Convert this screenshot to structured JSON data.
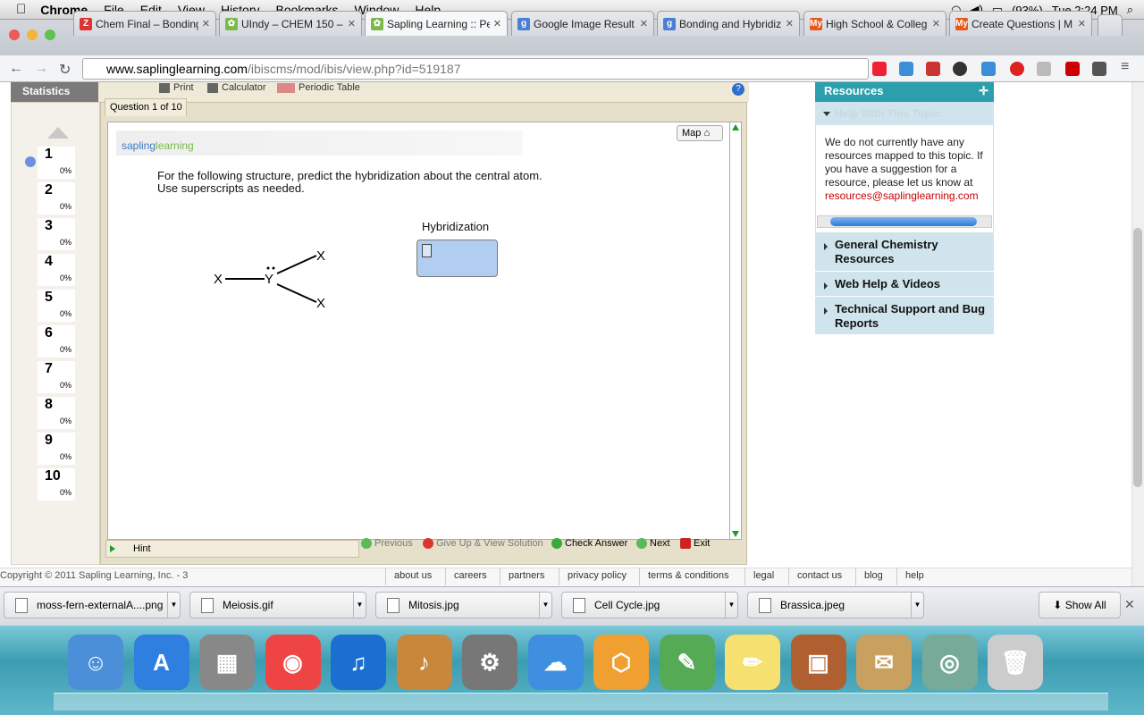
{
  "menubar": {
    "app": "Chrome",
    "items": [
      "File",
      "Edit",
      "View",
      "History",
      "Bookmarks",
      "Window",
      "Help"
    ],
    "battery": "(93%)",
    "clock": "Tue 2:24 PM"
  },
  "tabs": [
    {
      "title": "Chem Final – Bonding",
      "icon": "Z",
      "color": "#d33"
    },
    {
      "title": "UIndy – CHEM 150 –",
      "icon": "✿",
      "color": "#7bb94a"
    },
    {
      "title": "Sapling Learning :: Pe",
      "icon": "✿",
      "color": "#7bb94a"
    },
    {
      "title": "Google Image Result",
      "icon": "g",
      "color": "#4a7fd4"
    },
    {
      "title": "Bonding and Hybridiz",
      "icon": "g",
      "color": "#4a7fd4"
    },
    {
      "title": "High School & Colleg",
      "icon": "My",
      "color": "#e55a1c"
    },
    {
      "title": "Create Questions | M",
      "icon": "My",
      "color": "#e55a1c"
    }
  ],
  "url": {
    "host": "www.saplinglearning.com",
    "path": "/ibiscms/mod/ibis/view.php?id=519187"
  },
  "toolbar": {
    "statistics": "Statistics",
    "print": "Print",
    "calculator": "Calculator",
    "periodic_table": "Periodic Table"
  },
  "question": {
    "counter": "Question 1 of 10",
    "logo_a": "sapling",
    "logo_b": "learning",
    "map": "Map",
    "prompt_line1": "For the following structure, predict the hybridization about the central atom.",
    "prompt_line2": "Use superscripts as needed.",
    "hybridization_label": "Hybridization",
    "atom_center": "Y",
    "atom_x": "X"
  },
  "questions": [
    {
      "num": "1",
      "pct": "0%"
    },
    {
      "num": "2",
      "pct": "0%"
    },
    {
      "num": "3",
      "pct": "0%"
    },
    {
      "num": "4",
      "pct": "0%"
    },
    {
      "num": "5",
      "pct": "0%"
    },
    {
      "num": "6",
      "pct": "0%"
    },
    {
      "num": "7",
      "pct": "0%"
    },
    {
      "num": "8",
      "pct": "0%"
    },
    {
      "num": "9",
      "pct": "0%"
    },
    {
      "num": "10",
      "pct": "0%"
    }
  ],
  "actions": {
    "hint": "Hint",
    "previous": "Previous",
    "give_up": "Give Up & View Solution",
    "check": "Check Answer",
    "next": "Next",
    "exit": "Exit"
  },
  "resources": {
    "title": "Resources",
    "help_topic": "Help With This Topic",
    "text": "We do not currently have any resources mapped to this topic. If you have a suggestion for a resource, please let us know at",
    "email": "resources@saplinglearning.com",
    "items": [
      "General Chemistry Resources",
      "Web Help & Videos",
      "Technical Support and Bug Reports"
    ]
  },
  "footer": {
    "copyright": "Copyright © 2011 Sapling Learning, Inc. - 3",
    "links": [
      "about us",
      "careers",
      "partners",
      "privacy policy",
      "terms & conditions",
      "legal",
      "contact us",
      "blog",
      "help"
    ]
  },
  "downloads": {
    "files": [
      "moss-fern-externalA....png",
      "Meiosis.gif",
      "Mitosis.jpg",
      "Cell Cycle.jpg",
      "Brassica.jpeg"
    ],
    "show_all": "Show All"
  },
  "dock": [
    "finder-icon",
    "app-store-icon",
    "calculator-icon",
    "chrome-icon",
    "itunes-icon",
    "garageband-icon",
    "system-preferences-icon",
    "openoffice-icon",
    "cube-app-icon",
    "evernote-icon",
    "notes-icon",
    "iphoto-icon",
    "mail-icon",
    "preview-icon",
    "trash-icon"
  ]
}
